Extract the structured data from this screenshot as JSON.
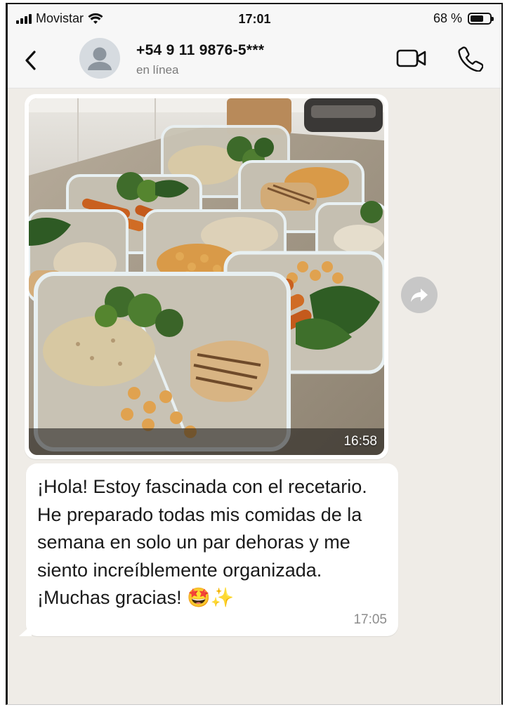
{
  "status_bar": {
    "carrier": "Movistar",
    "time": "17:01",
    "battery_text": "68 %",
    "battery_level": 0.68
  },
  "header": {
    "contact_name": "+54 9 11 9876-5***",
    "contact_status": "en línea",
    "icons": [
      "back-arrow-icon",
      "avatar-placeholder-icon",
      "video-call-icon",
      "phone-icon"
    ]
  },
  "messages": {
    "image": {
      "timestamp": "16:58",
      "content": "meal-prep-containers-photo"
    },
    "text": {
      "body": "¡Hola! Estoy fascinada con el recetario. He preparado todas mis comidas de la semana en solo un par dehoras y me siento increíblemente organizada. ¡Muchas gracias! 🤩✨",
      "timestamp": "17:05"
    }
  },
  "colors": {
    "chat_background": "#efece7",
    "bubble": "#ffffff",
    "header_background": "#f7f7f7",
    "forward_button": "#c7c7c7"
  }
}
